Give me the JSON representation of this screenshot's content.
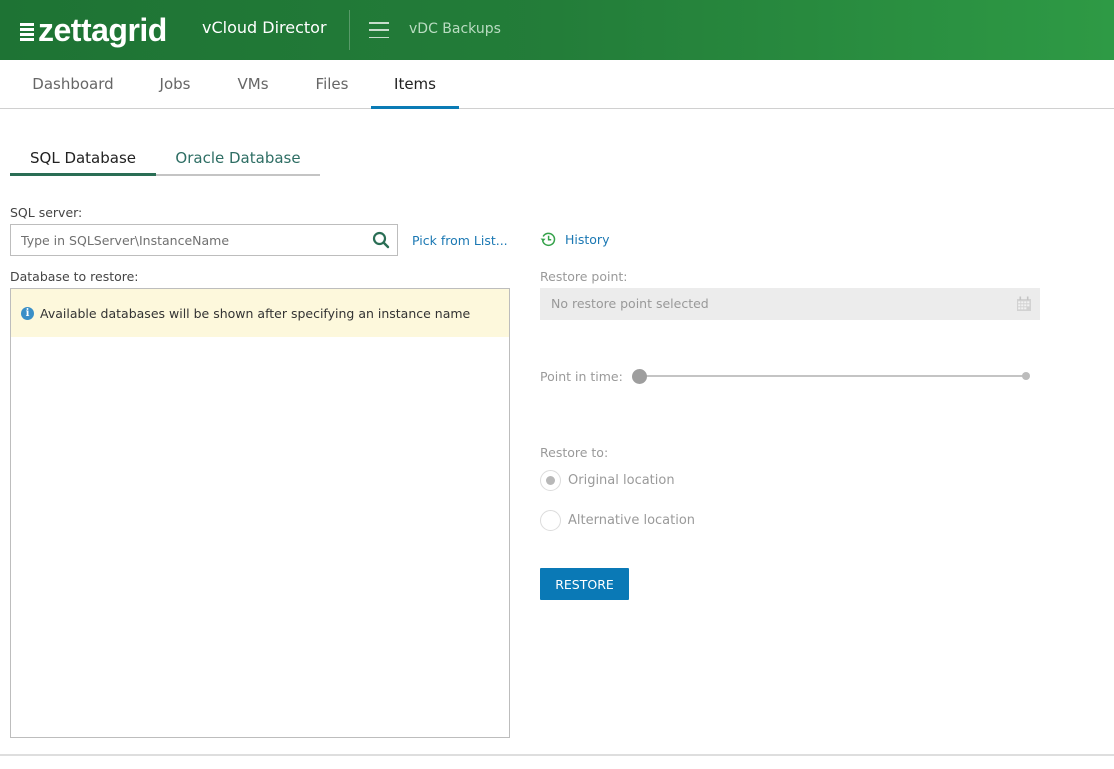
{
  "header": {
    "logo_text": "zettagrid",
    "app_title": "vCloud Director",
    "menu_icon": "hamburger-menu-icon",
    "breadcrumb": "vDC Backups",
    "colors": {
      "gradient_start": "#1e7334",
      "gradient_end": "#2e9a45"
    }
  },
  "nav": {
    "tabs": [
      {
        "label": "Dashboard",
        "active": false
      },
      {
        "label": "Jobs",
        "active": false
      },
      {
        "label": "VMs",
        "active": false
      },
      {
        "label": "Files",
        "active": false
      },
      {
        "label": "Items",
        "active": true
      }
    ],
    "active_color": "#0a7bb5"
  },
  "subtabs": [
    {
      "label": "SQL Database",
      "active": true
    },
    {
      "label": "Oracle Database",
      "active": false
    }
  ],
  "form": {
    "sql_server_label": "SQL server:",
    "sql_server_value": "",
    "sql_server_placeholder": "Type in SQLServer\\InstanceName",
    "search_icon": "search-icon",
    "pick_from_list": "Pick from List...",
    "history_label": "History",
    "history_icon": "history-clock-icon",
    "database_label": "Database to restore:",
    "notice_icon": "info-icon",
    "notice_text": "Available databases will be shown after specifying an instance name",
    "restore_point_label": "Restore point:",
    "restore_point_value": "No restore point selected",
    "calendar_icon": "calendar-icon",
    "point_in_time_label": "Point in time:",
    "point_in_time_position": 0,
    "restore_to_label": "Restore to:",
    "restore_options": [
      {
        "label": "Original location",
        "checked": true
      },
      {
        "label": "Alternative location",
        "checked": false
      }
    ],
    "restore_button": "RESTORE",
    "button_color": "#0a79b6"
  }
}
